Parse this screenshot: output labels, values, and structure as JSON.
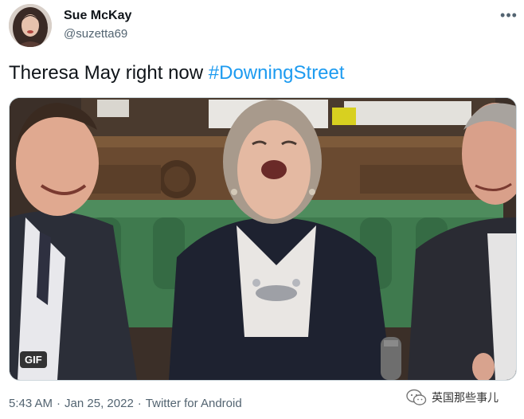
{
  "author": {
    "display_name": "Sue McKay",
    "handle": "@suzetta69",
    "avatar_icon": "profile-photo"
  },
  "more_icon": "more-horizontal-icon",
  "more_glyph": "•••",
  "tweet": {
    "text": "Theresa May right now ",
    "hashtag": "#DowningStreet"
  },
  "media": {
    "badge": "GIF"
  },
  "meta": {
    "time": "5:43 AM",
    "date": "Jan 25, 2022",
    "source": "Twitter for Android",
    "separator": "·"
  },
  "watermark": {
    "icon": "wechat-icon",
    "text": "英国那些事儿"
  },
  "colors": {
    "hashtag": "#1d9bf0",
    "secondary_text": "#536471",
    "primary_text": "#0f1419"
  }
}
